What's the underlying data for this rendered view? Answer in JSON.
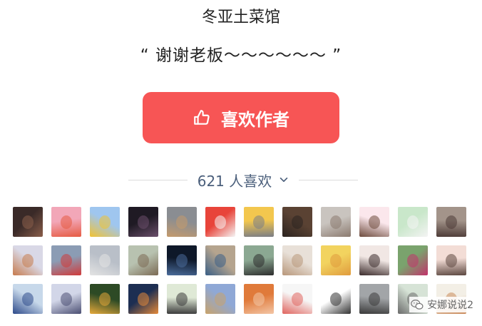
{
  "author": "冬亚土菜馆",
  "message": "“ 谢谢老板～～～～～～ ”",
  "like_button": {
    "label": "喜欢作者",
    "icon": "thumbs-up-icon"
  },
  "like_count": {
    "text": "621 人喜欢",
    "icon": "chevron-down-icon"
  },
  "colors": {
    "accent": "#f75555",
    "count_text": "#4b5f7b",
    "divider": "#dcdcdc"
  },
  "avatars": [
    {
      "colors": [
        "#3a2a28",
        "#8a5e4a"
      ]
    },
    {
      "colors": [
        "#f2a7b8",
        "#e65b43"
      ]
    },
    {
      "colors": [
        "#9fc6ef",
        "#f1c232"
      ]
    },
    {
      "colors": [
        "#1f1a24",
        "#6b4f6b"
      ]
    },
    {
      "colors": [
        "#8a8d92",
        "#c49a6c"
      ]
    },
    {
      "colors": [
        "#e8443a",
        "#f5f5f5"
      ]
    },
    {
      "colors": [
        "#f3c74e",
        "#7a7d86"
      ]
    },
    {
      "colors": [
        "#5a4233",
        "#2c2420"
      ]
    },
    {
      "colors": [
        "#c9c4bf",
        "#8b7a6f"
      ]
    },
    {
      "colors": [
        "#fbe7ec",
        "#6d4b3d"
      ]
    },
    {
      "colors": [
        "#c9e7ca",
        "#f4f4f4"
      ]
    },
    {
      "colors": [
        "#a3948a",
        "#4d3b37"
      ]
    },
    {
      "colors": [
        "#d9d8e6",
        "#c77b4d"
      ]
    },
    {
      "colors": [
        "#8b9cb4",
        "#d03a3a"
      ]
    },
    {
      "colors": [
        "#b9bfc8",
        "#e3e3e3"
      ]
    },
    {
      "colors": [
        "#b8c2b0",
        "#7b6a54"
      ]
    },
    {
      "colors": [
        "#0e1829",
        "#4a6c9b"
      ]
    },
    {
      "colors": [
        "#b5a48e",
        "#3a5f86"
      ]
    },
    {
      "colors": [
        "#8ba892",
        "#2d2d2d"
      ]
    },
    {
      "colors": [
        "#e8e0d8",
        "#b8977a"
      ]
    },
    {
      "colors": [
        "#f2d35f",
        "#e09b3d"
      ]
    },
    {
      "colors": [
        "#f1e7e4",
        "#3b2b2b"
      ]
    },
    {
      "colors": [
        "#7aa36d",
        "#c2336b"
      ]
    },
    {
      "colors": [
        "#f3ddd6",
        "#5c4740"
      ]
    },
    {
      "colors": [
        "#c7d8ea",
        "#2d4a8a"
      ]
    },
    {
      "colors": [
        "#d2d6e8",
        "#4a4e72"
      ]
    },
    {
      "colors": [
        "#2d4a25",
        "#e5a83a"
      ]
    },
    {
      "colors": [
        "#1d2e52",
        "#e58a3a"
      ]
    },
    {
      "colors": [
        "#dfe9d6",
        "#3b3b3b"
      ]
    },
    {
      "colors": [
        "#8fa8d6",
        "#c9a36b"
      ]
    },
    {
      "colors": [
        "#e07a3a",
        "#f3c6a6"
      ]
    },
    {
      "colors": [
        "#f6f6f6",
        "#e0645e"
      ]
    },
    {
      "colors": [
        "#ffffff",
        "#333333"
      ]
    },
    {
      "colors": [
        "#a2a5a8",
        "#3a3a3a"
      ]
    },
    {
      "colors": [
        "#d6e3d6",
        "#6b6b6b"
      ]
    },
    {
      "colors": [
        "#f3efe6",
        "#c98a5a"
      ]
    }
  ],
  "watermark": {
    "text": "安娜说说2",
    "icon": "wechat-icon"
  }
}
